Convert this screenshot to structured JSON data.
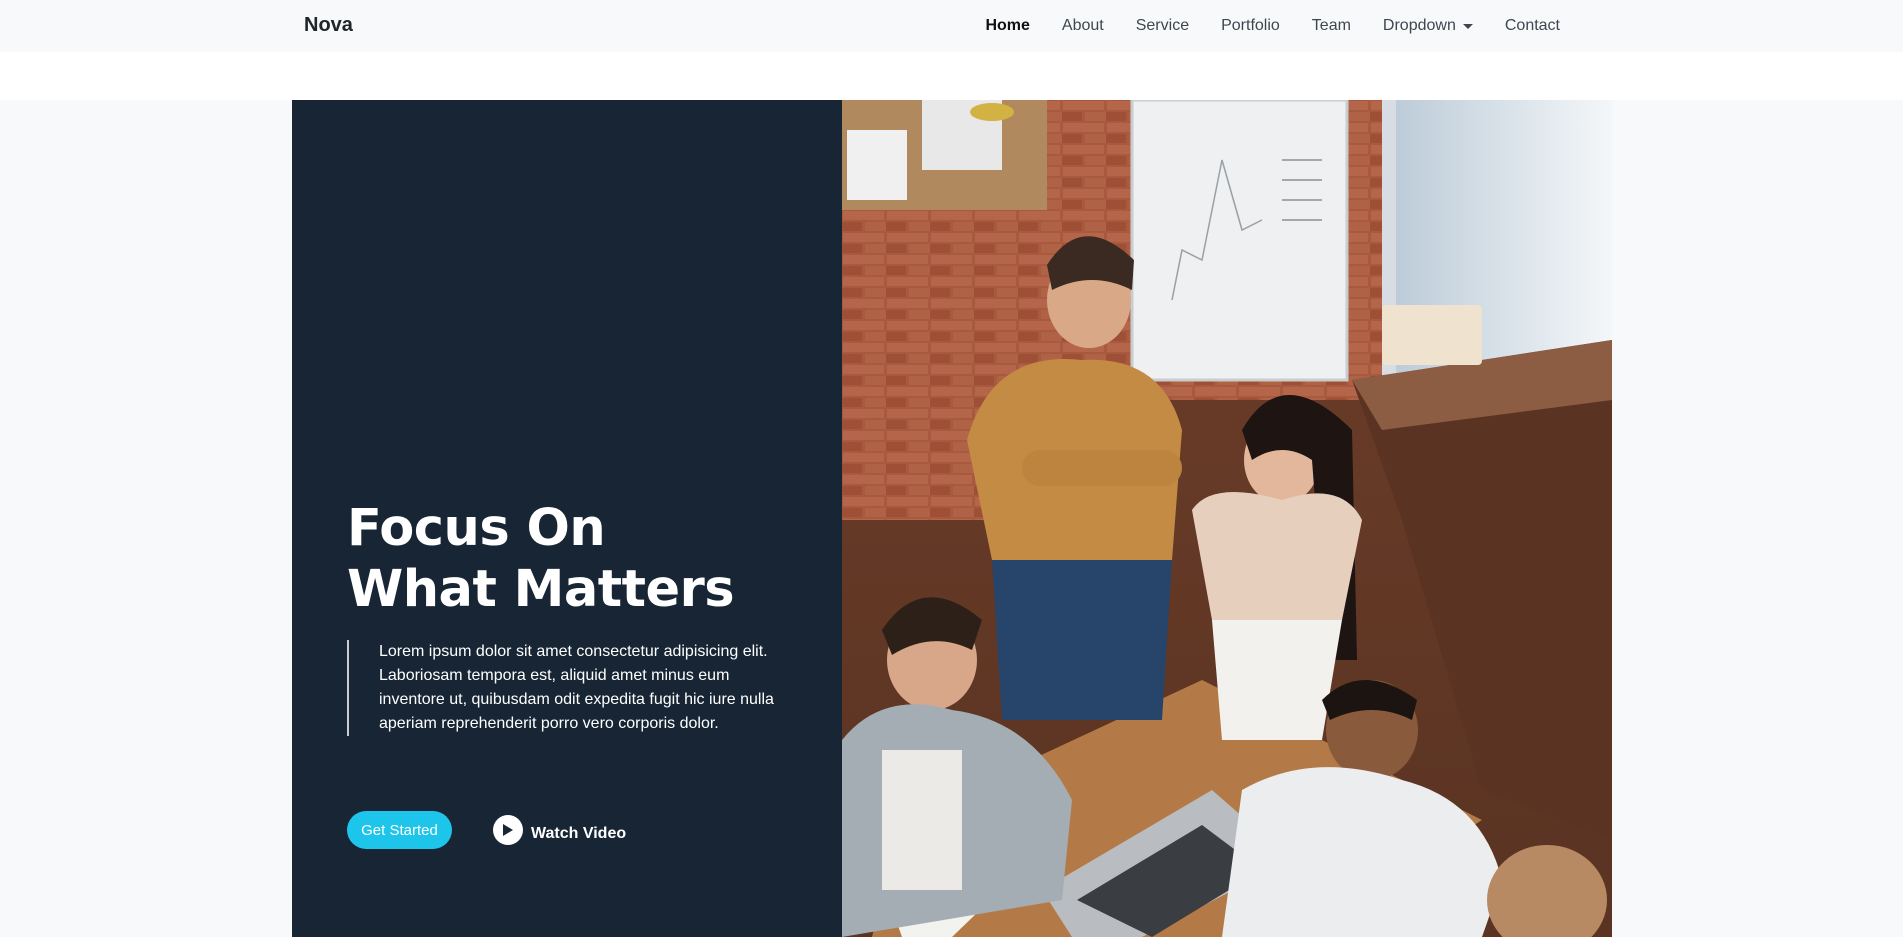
{
  "navbar": {
    "brand": "Nova",
    "links": [
      {
        "label": "Home",
        "active": true
      },
      {
        "label": "About"
      },
      {
        "label": "Service"
      },
      {
        "label": "Portfolio"
      },
      {
        "label": "Team"
      },
      {
        "label": "Dropdown",
        "has_caret": true
      },
      {
        "label": "Contact"
      }
    ]
  },
  "hero": {
    "title": "Focus On What Matters",
    "quote": "Lorem ipsum dolor sit amet consectetur adipisicing elit. Laboriosam tempora est, aliquid amet minus eum inventore ut, quibusdam odit expedita fugit hic iure nulla aperiam reprehenderit porro vero corporis dolor.",
    "primary_button": "Get Started",
    "video_link": "Watch Video",
    "photo_icon": "team-meeting-photo"
  },
  "colors": {
    "accent": "#1ec5ea",
    "hero_dark": "#172535",
    "nav_bg": "#f8f9fa"
  }
}
